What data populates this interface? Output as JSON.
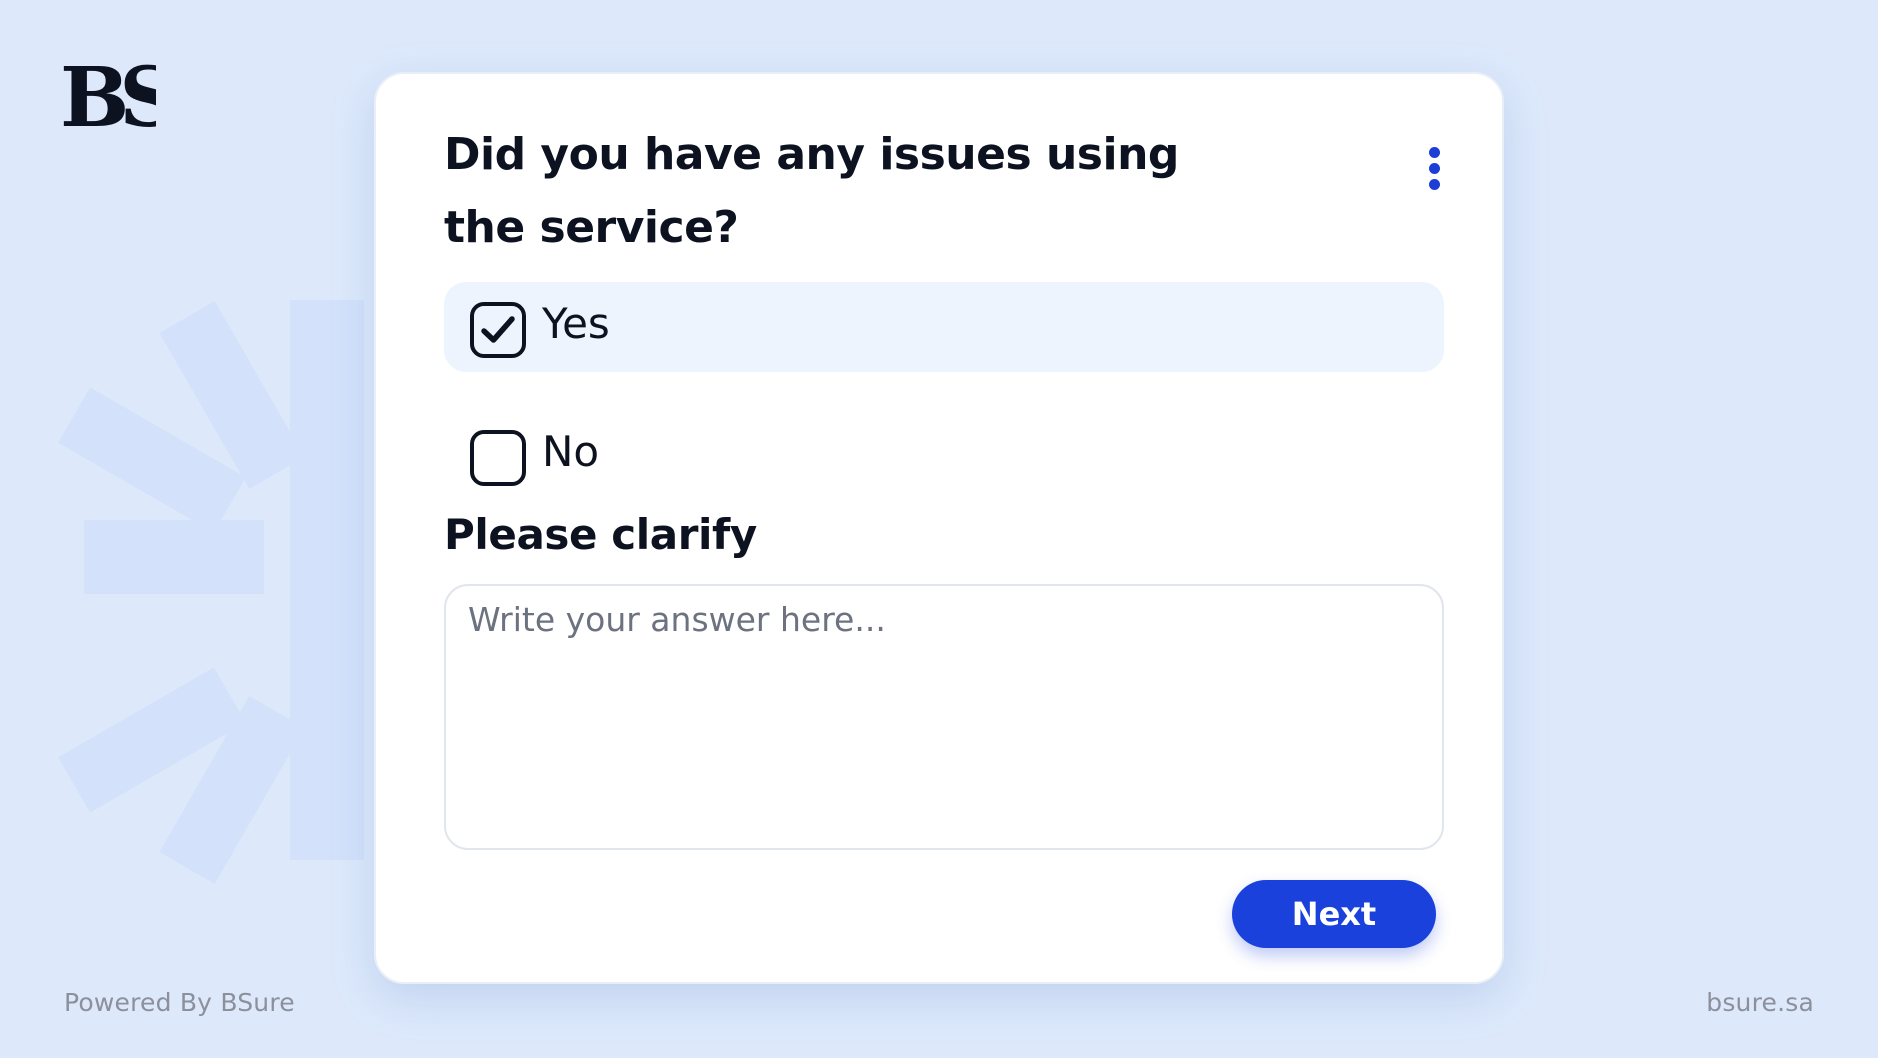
{
  "brand": {
    "logo_text": "BS",
    "powered_by": "Powered By BSure",
    "website": "bsure.sa"
  },
  "survey": {
    "question": "Did you have any issues using the service?",
    "options": [
      {
        "label": "Yes",
        "checked": true
      },
      {
        "label": "No",
        "checked": false
      }
    ],
    "clarify_label": "Please clarify",
    "answer_placeholder": "Write your answer here...",
    "next_label": "Next"
  },
  "icons": {
    "menu": "kebab-menu-icon",
    "checkmark": "checkmark-icon",
    "logo": "bsure-logo-icon",
    "background": "starburst-icon"
  },
  "colors": {
    "background": "#dde9fb",
    "accent": "#1a41dc",
    "text": "#0d1220",
    "selected_option": "#eef4fe",
    "muted": "#8b909b"
  }
}
